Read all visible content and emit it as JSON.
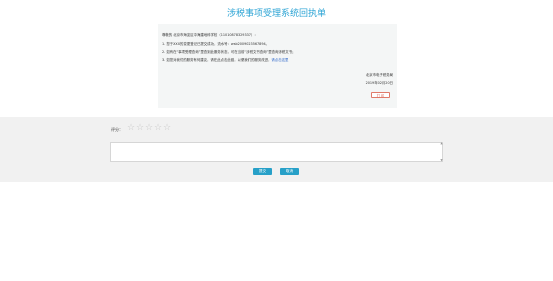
{
  "header": {
    "title": "涉税事项受理系统回执单"
  },
  "receipt": {
    "greeting": "尊敬的 北京市海淀区中海建地科学校（11010878329337）：",
    "line1": "1. 您于XXX的变更登记已提交成功，流水号：wsb2009023567894。",
    "line2": "2. 如有在“事项受理查询”里查到此服务状态，可在当前“涉税文书查询”里查询涉税文书；",
    "line3_prefix": "3. 如您对我们的服务有何建议，请在此点击此链，以便我们的服务改进，",
    "line3_link": "请点击这里",
    "signer": "北京市电子税务局",
    "date": "2019年02月20日",
    "print_label": "打 印"
  },
  "feedback": {
    "rating_label": "评分：",
    "rating_value": 0,
    "rating_max": 5,
    "comment_value": "",
    "submit_label": "提交",
    "cancel_label": "取消"
  },
  "icons": {
    "star": "star-outline-icon",
    "scroll_up": "triangle-up-icon",
    "scroll_down": "triangle-down-icon"
  },
  "colors": {
    "accent": "#2aa3d4",
    "button": "#27a0c8",
    "print_border": "#e07a6a",
    "link": "#2a64c8",
    "star_empty": "#c8c8c8"
  }
}
